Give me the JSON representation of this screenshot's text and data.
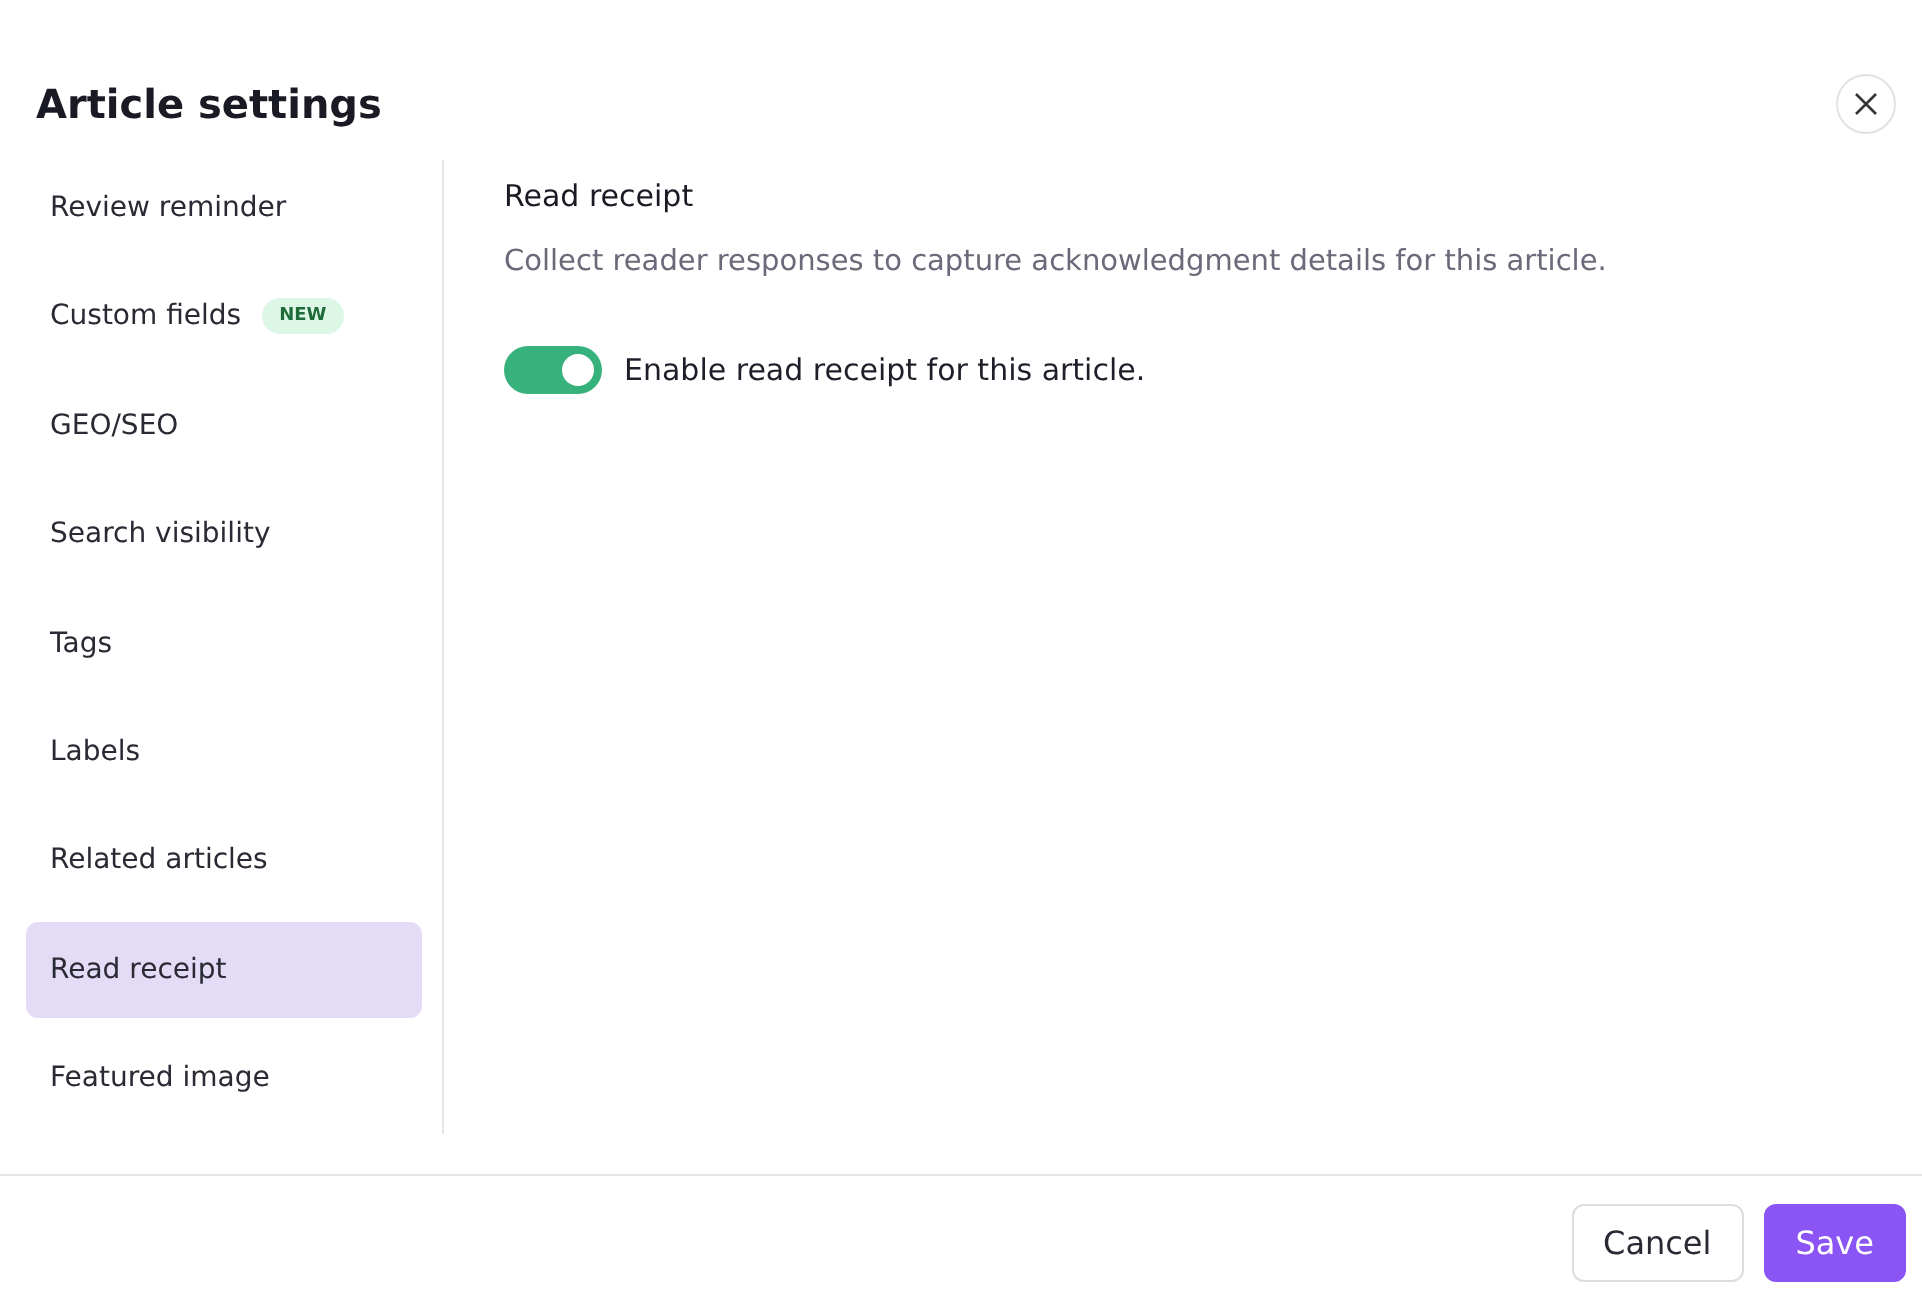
{
  "dialog": {
    "title": "Article settings"
  },
  "sidebar": {
    "items": [
      {
        "label": "Review reminder",
        "selected": false
      },
      {
        "label": "Custom fields",
        "selected": false,
        "badge": "NEW"
      },
      {
        "label": "GEO/SEO",
        "selected": false
      },
      {
        "label": "Search visibility",
        "selected": false
      },
      {
        "label": "Tags",
        "selected": false
      },
      {
        "label": "Labels",
        "selected": false
      },
      {
        "label": "Related articles",
        "selected": false
      },
      {
        "label": "Read receipt",
        "selected": true
      },
      {
        "label": "Featured image",
        "selected": false
      }
    ]
  },
  "panel": {
    "heading": "Read receipt",
    "description": "Collect reader responses to capture acknowledgment details for this article.",
    "toggle": {
      "label": "Enable read receipt for this article.",
      "on": true
    }
  },
  "footer": {
    "buttons": [
      {
        "label": "Cancel",
        "kind": "secondary"
      },
      {
        "label": "Save",
        "kind": "primary"
      }
    ]
  }
}
